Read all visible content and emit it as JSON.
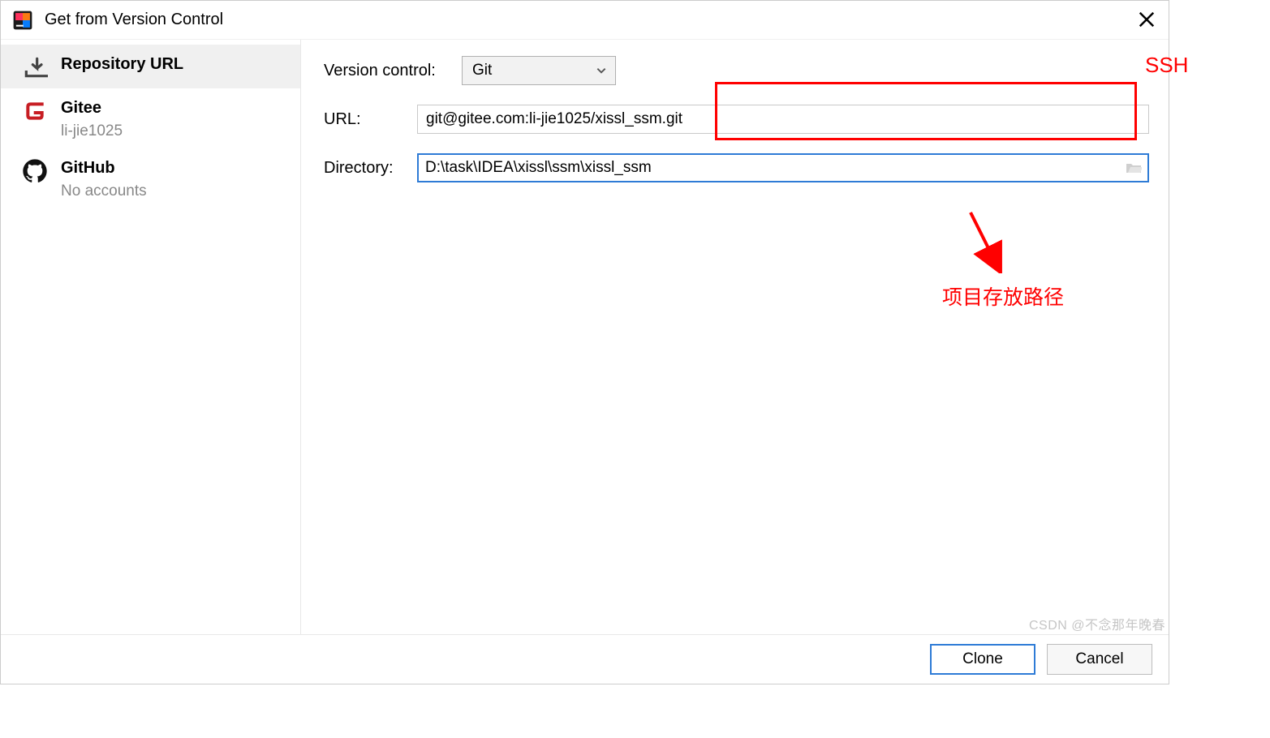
{
  "dialog": {
    "title": "Get from Version Control"
  },
  "sidebar": {
    "items": [
      {
        "title": "Repository URL",
        "sub": ""
      },
      {
        "title": "Gitee",
        "sub": "li-jie1025"
      },
      {
        "title": "GitHub",
        "sub": "No accounts"
      }
    ]
  },
  "form": {
    "vc_label": "Version control:",
    "vc_value": "Git",
    "url_label": "URL:",
    "url_value": "git@gitee.com:li-jie1025/xissl_ssm.git",
    "dir_label": "Directory:",
    "dir_value": "D:\\task\\IDEA\\xissl\\ssm\\xissl_ssm"
  },
  "annotations": {
    "ssh": "SSH",
    "path": "项目存放路径"
  },
  "footer": {
    "clone": "Clone",
    "cancel": "Cancel"
  },
  "watermark": "CSDN @不念那年晚春"
}
